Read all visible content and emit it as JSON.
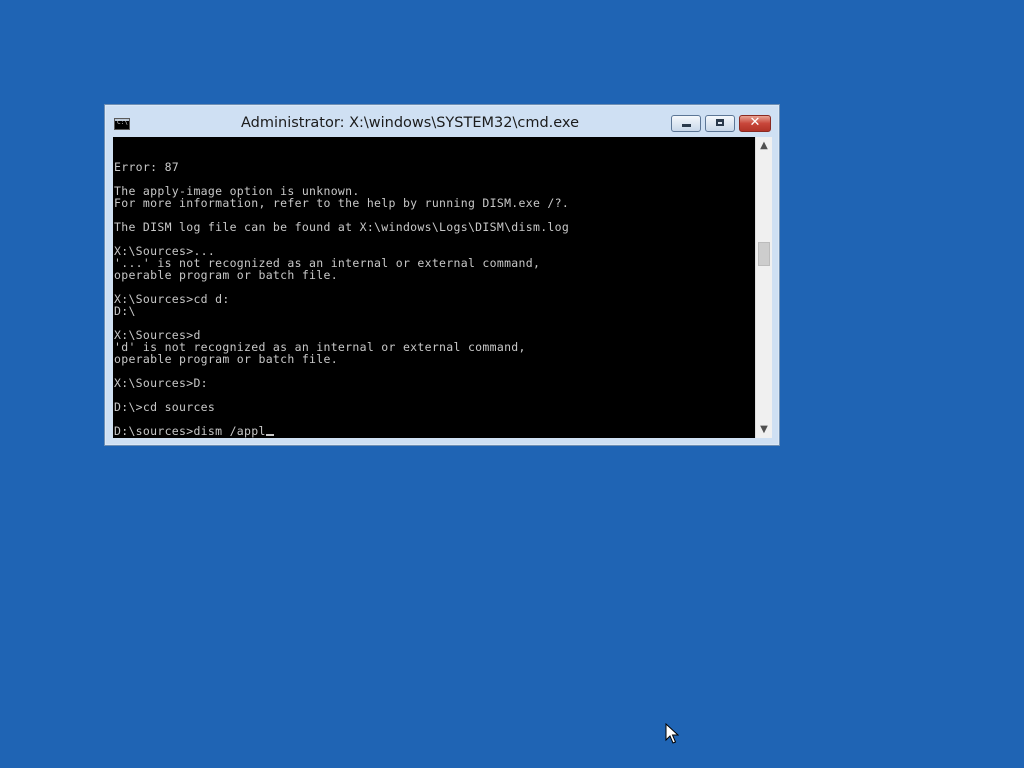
{
  "window": {
    "title": "Administrator: X:\\windows\\SYSTEM32\\cmd.exe",
    "icon": "cmd-icon",
    "buttons": {
      "minimize_icon": "minimize-icon",
      "maximize_icon": "maximize-icon",
      "close_icon": "close-icon"
    }
  },
  "console": {
    "lines": [
      "Error: 87",
      "",
      "The apply-image option is unknown.",
      "For more information, refer to the help by running DISM.exe /?.",
      "",
      "The DISM log file can be found at X:\\windows\\Logs\\DISM\\dism.log",
      "",
      "X:\\Sources>...",
      "'...' is not recognized as an internal or external command,",
      "operable program or batch file.",
      "",
      "X:\\Sources>cd d:",
      "D:\\",
      "",
      "X:\\Sources>d",
      "'d' is not recognized as an internal or external command,",
      "operable program or batch file.",
      "",
      "X:\\Sources>D:",
      "",
      "D:\\>cd sources",
      ""
    ],
    "current_input": "D:\\sources>dism /appl"
  },
  "colors": {
    "desktop": "#1f64b4",
    "console_bg": "#000000",
    "console_text": "#c8c8c8"
  },
  "icons": {
    "scroll_up": "scroll-up-arrow-icon",
    "scroll_down": "scroll-down-arrow-icon",
    "pointer": "mouse-pointer-icon"
  }
}
